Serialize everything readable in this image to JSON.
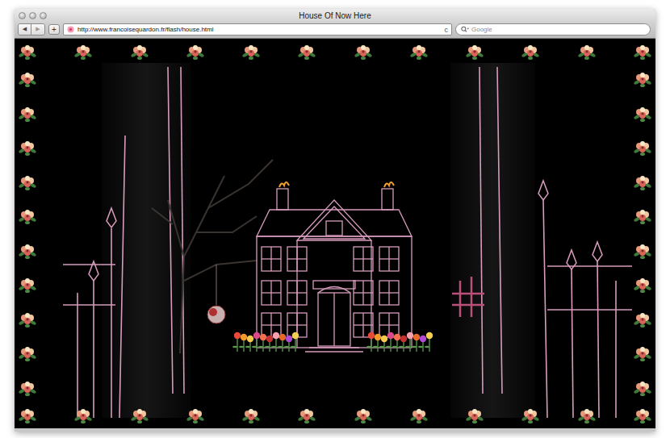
{
  "window": {
    "title": "House Of Now Here"
  },
  "toolbar": {
    "back": "◀",
    "forward": "▶",
    "add": "+",
    "reload": "c",
    "url": "http://www.francoisequardon.fr/flash/house.html",
    "search_placeholder": "Google"
  }
}
